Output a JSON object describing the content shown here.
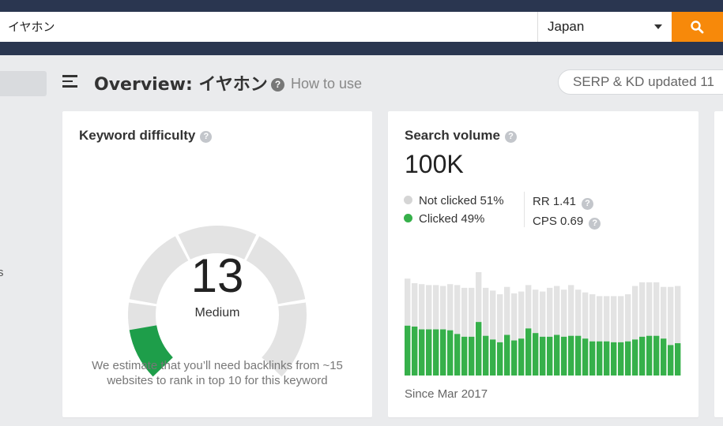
{
  "search": {
    "query": "イヤホン",
    "country": "Japan"
  },
  "header": {
    "title": "Overview: イヤホン",
    "how_to_use": "How to use",
    "update_status": "SERP & KD updated 11"
  },
  "sidebar": {
    "partial_text": "s"
  },
  "keyword_difficulty": {
    "title": "Keyword difficulty",
    "value": "13",
    "level": "Medium",
    "score": 13,
    "note": "We estimate that you’ll need backlinks from ~15 websites to rank in top 10 for this keyword"
  },
  "search_volume": {
    "title": "Search volume",
    "value": "100K",
    "not_clicked": "Not clicked 51%",
    "clicked": "Clicked 49%",
    "rr": "RR 1.41",
    "cps": "CPS 0.69",
    "since": "Since Mar 2017"
  },
  "colors": {
    "accent": "#f7890a",
    "topbar": "#2a3650",
    "green": "#36b04a",
    "grey": "#e3e3e3",
    "gauge_green": "#1e9e4a"
  },
  "chart_data": {
    "type": "bar",
    "title": "",
    "xlabel": "",
    "ylabel": "",
    "ylim": [
      0,
      100
    ],
    "series": [
      {
        "name": "Clicked",
        "values": [
          54,
          53,
          50,
          50,
          50,
          50,
          49,
          45,
          42,
          42,
          58,
          43,
          39,
          36,
          44,
          38,
          40,
          51,
          46,
          42,
          42,
          44,
          42,
          43,
          43,
          40,
          37,
          37,
          37,
          36,
          36,
          37,
          39,
          42,
          43,
          43,
          40,
          33,
          35
        ]
      },
      {
        "name": "Not clicked",
        "values": [
          51,
          47,
          49,
          48,
          48,
          47,
          50,
          53,
          53,
          53,
          54,
          52,
          53,
          52,
          52,
          51,
          51,
          47,
          47,
          49,
          53,
          53,
          51,
          55,
          50,
          50,
          51,
          49,
          49,
          50,
          50,
          51,
          58,
          59,
          58,
          58,
          56,
          63,
          62
        ]
      }
    ]
  }
}
